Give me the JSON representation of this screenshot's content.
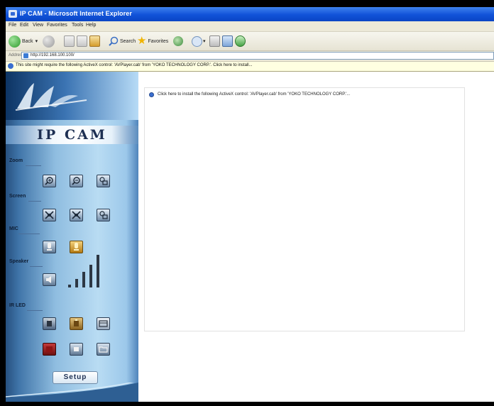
{
  "browser": {
    "title": "IP CAM - Microsoft Internet Explorer",
    "menu": [
      "File",
      "Edit",
      "View",
      "Favorites",
      "Tools",
      "Help"
    ],
    "toolbar": {
      "back_label": "Back",
      "search_label": "Search",
      "favorites_label": "Favorites"
    },
    "address": {
      "label": "Address",
      "url": "http://192.168.100.100/"
    },
    "infobar": {
      "text": "This site might require the following ActiveX control: 'AVPlayer.cab' from 'YOKO TECHNOLOGY CORP.'. Click here to install..."
    }
  },
  "sidebar": {
    "title": "IP CAM",
    "sections": {
      "zoom": "Zoom",
      "screen": "Screen",
      "mic": "MIC",
      "speaker": "Speaker",
      "irled": "IR LED"
    },
    "setup_label": "Setup"
  },
  "content": {
    "activex_prompt": "Click here to install the following ActiveX control: 'AVPlayer.cab' from 'YOKO TECHNOLOGY CORP.'..."
  },
  "colors": {
    "titlebar": "#1152d8",
    "sidebar": "#8fbde0",
    "infobar": "#ffffe1"
  },
  "icons": {
    "zoom": [
      "zoom-in-icon",
      "zoom-out-icon",
      "zoom-reset-icon"
    ],
    "screen": [
      "fullscreen-icon",
      "normal-screen-icon",
      "screen-reset-icon"
    ],
    "mic": [
      "mic-off-icon",
      "mic-on-icon"
    ],
    "speaker": [
      "speaker-icon",
      "volume-level-icon"
    ],
    "irled": [
      "ir-led-off-icon",
      "ir-led-on-icon",
      "ir-led-auto-icon",
      "record-icon",
      "snapshot-icon",
      "folder-icon"
    ]
  }
}
